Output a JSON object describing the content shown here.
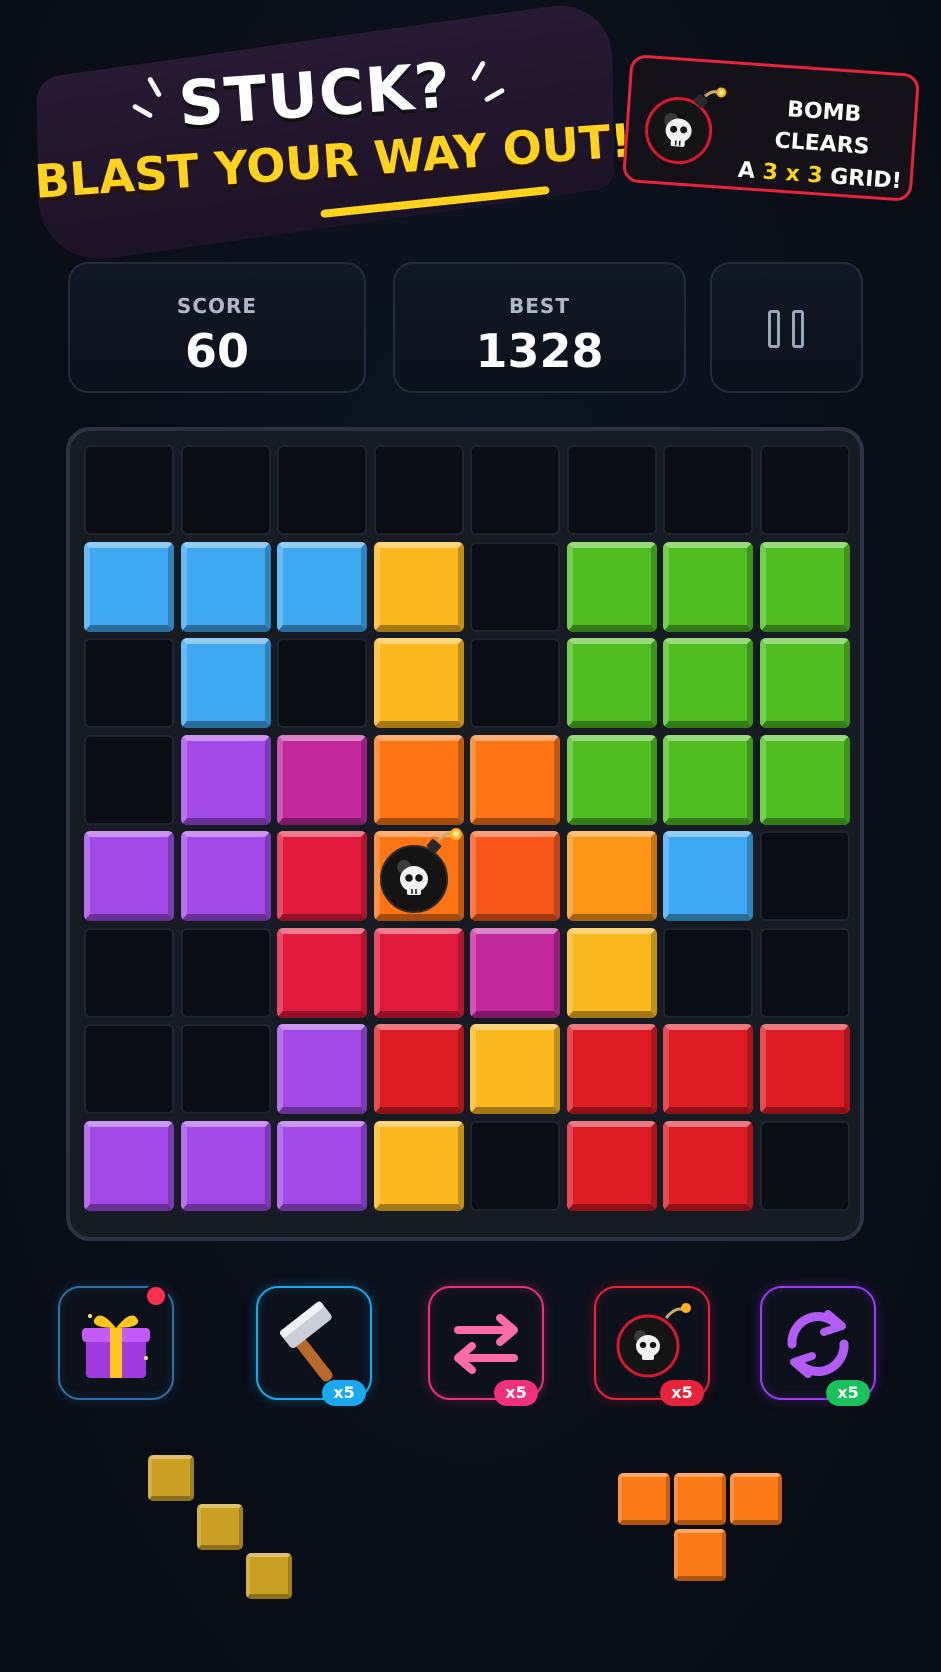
{
  "banner": {
    "headline_line1": "STUCK?",
    "headline_line2": "BLAST YOUR WAY OUT!",
    "tip": {
      "line1": "BOMB CLEARS",
      "line2_prefix": "A ",
      "line2_highlight": "3 x 3",
      "line2_suffix": " GRID!",
      "icon": "bomb-icon",
      "border_color": "#e8243b"
    }
  },
  "stats": {
    "score": {
      "label": "SCORE",
      "value": "60"
    },
    "best": {
      "label": "BEST",
      "value": "1328"
    },
    "pause_icon": "pause-icon"
  },
  "palette": {
    "blue": "#3fa8f2",
    "yellow": "#fbb71e",
    "green": "#4fbf22",
    "purple": "#a24ae8",
    "magenta": "#c2289b",
    "orange": "#fc7414",
    "red_orange": "#f9561c",
    "crimson": "#e31a3d",
    "red": "#dd1c24",
    "orange_yellow": "#fc9516"
  },
  "board": {
    "size": 8,
    "rows": [
      [
        "empty",
        "empty",
        "empty",
        "empty",
        "empty",
        "empty",
        "empty",
        "empty"
      ],
      [
        "blue",
        "blue",
        "blue",
        "yellow",
        "empty",
        "green",
        "green",
        "green"
      ],
      [
        "empty",
        "blue",
        "empty",
        "yellow",
        "empty",
        "green",
        "green",
        "green"
      ],
      [
        "empty",
        "purple",
        "magenta",
        "orange",
        "orange",
        "green",
        "green",
        "green"
      ],
      [
        "purple",
        "purple",
        "crimson",
        "orange",
        "red_orange",
        "orange_yellow",
        "blue",
        "empty"
      ],
      [
        "empty",
        "empty",
        "crimson",
        "crimson",
        "magenta",
        "yellow",
        "empty",
        "empty"
      ],
      [
        "empty",
        "empty",
        "purple",
        "red",
        "yellow",
        "red",
        "red",
        "red"
      ],
      [
        "purple",
        "purple",
        "purple",
        "yellow",
        "empty",
        "red",
        "red",
        "empty"
      ]
    ],
    "bomb": {
      "row": 4,
      "col": 3,
      "icon": "bomb-icon"
    }
  },
  "powerups": [
    {
      "name": "gift",
      "icon": "gift-icon",
      "count": "",
      "color": "#2f6fa8",
      "has_notification": true
    },
    {
      "name": "hammer",
      "icon": "hammer-icon",
      "count": "x5",
      "color": "#1aa8f0"
    },
    {
      "name": "swap",
      "icon": "swap-arrows-icon",
      "count": "x5",
      "color": "#f0307a"
    },
    {
      "name": "bomb",
      "icon": "bomb-icon",
      "count": "x5",
      "color": "#e8243b"
    },
    {
      "name": "refresh",
      "icon": "refresh-icon",
      "count": "x5",
      "color": "#9a3cf0",
      "badge_color": "#19c25a"
    }
  ],
  "pieces": [
    {
      "name": "diagonal-piece",
      "color": "#c9a022",
      "cells": [
        [
          0,
          0
        ],
        [
          1,
          1
        ],
        [
          2,
          2
        ]
      ]
    },
    {
      "name": "t-piece",
      "color": "#fb7a15",
      "cells": [
        [
          0,
          0
        ],
        [
          0,
          1
        ],
        [
          0,
          2
        ],
        [
          1,
          1
        ]
      ]
    }
  ]
}
